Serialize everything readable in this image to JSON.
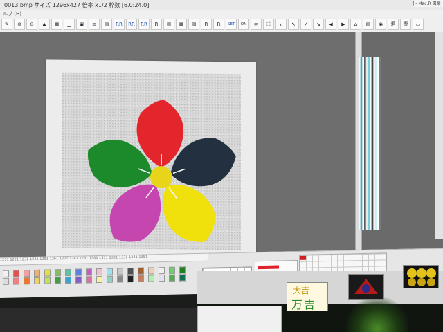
{
  "window": {
    "title": "0013.bmp サイズ 1296x427 倍率 x1/2 枠数 [6.0:24.0]",
    "side_title": "] - Mac.R 図案",
    "menu_fragment": "ルプ (H)"
  },
  "toolbar": {
    "buttons": [
      {
        "label": "✎",
        "name": "edit-tool-button"
      },
      {
        "label": "⊕",
        "name": "zoom-in-button"
      },
      {
        "label": "⊖",
        "name": "zoom-out-button"
      },
      {
        "label": "▲",
        "name": "fit-button"
      },
      {
        "label": "▦",
        "name": "grid-button"
      },
      {
        "label": "▁",
        "name": "baseline-button"
      },
      {
        "label": "▣",
        "name": "layer-button"
      },
      {
        "label": "≡",
        "name": "color-table-button"
      },
      {
        "label": "▤",
        "name": "palette-button"
      },
      {
        "label": "RR",
        "name": "rr-button-1"
      },
      {
        "label": "RR",
        "name": "rr-button-2"
      },
      {
        "label": "RR",
        "name": "rr-button-3"
      },
      {
        "label": "R",
        "name": "r-button-1"
      },
      {
        "label": "▥",
        "name": "pattern-button-1"
      },
      {
        "label": "▦",
        "name": "pattern-button-2"
      },
      {
        "label": "▧",
        "name": "pattern-button-3"
      },
      {
        "label": "R",
        "name": "r-button-2"
      },
      {
        "label": "R",
        "name": "r-button-3"
      },
      {
        "label": "SET",
        "name": "set-button"
      },
      {
        "label": "ON OFF",
        "name": "on-off-toggle"
      },
      {
        "label": "⇄",
        "name": "swap-button"
      },
      {
        "label": "⛶",
        "name": "binoculars-button"
      },
      {
        "label": "↙",
        "name": "arrow-button-1"
      },
      {
        "label": "↖",
        "name": "arrow-button-2"
      },
      {
        "label": "↗",
        "name": "arrow-button-3"
      },
      {
        "label": "↘",
        "name": "arrow-button-4"
      },
      {
        "label": "◀",
        "name": "prev-button"
      },
      {
        "label": "▶",
        "name": "next-button"
      },
      {
        "label": "⌂",
        "name": "home-button"
      },
      {
        "label": "▤",
        "name": "list-button"
      },
      {
        "label": "◉",
        "name": "color-wheel-button"
      },
      {
        "label": "退",
        "name": "undo-button"
      },
      {
        "label": "復",
        "name": "redo-button"
      },
      {
        "label": "▭",
        "name": "window-button"
      }
    ]
  },
  "design": {
    "petals": [
      {
        "color": "#e2262b",
        "name": "red-petal"
      },
      {
        "color": "#23303f",
        "name": "navy-petal"
      },
      {
        "color": "#f0e10c",
        "name": "yellow-petal"
      },
      {
        "color": "#c646b0",
        "name": "magenta-petal"
      },
      {
        "color": "#1c8a2a",
        "name": "green-petal"
      }
    ],
    "center_color": "#e8d418"
  },
  "stripes": [
    "#f4f4f4",
    "#3ab0c8",
    "#ffffff",
    "#5a5a5a",
    "#e8e8e8",
    "#6fd0e0",
    "#ffffff",
    "#444444",
    "#f0f0f0",
    "#c8f0f4",
    "#ffffff",
    "#7a7a7a"
  ],
  "bottom": {
    "ruler_text": "1211 1221 1231 1241 1251 1261 1271 1281 1291 1301 1311 1321 1331 1341 1351",
    "thumb1_top": "大吉",
    "thumb1_bottom": "万吉"
  },
  "palette": {
    "colors": [
      "#f2f2f2",
      "#dcdcdc",
      "#e05050",
      "#f08080",
      "#f0a0a0",
      "#e87830",
      "#f0b070",
      "#f0d060",
      "#e0e040",
      "#c0e060",
      "#80c060",
      "#40a040",
      "#60c0a0",
      "#40a0d0",
      "#6080e0",
      "#8060c0",
      "#c060c0",
      "#e070a0",
      "#f0c0d0",
      "#f6f0a0",
      "#a0e0f0",
      "#90d0c0",
      "#c8c8c8",
      "#888888",
      "#505050",
      "#202020",
      "#a06030",
      "#c08060",
      "#f0d0b0",
      "#b0f0b0",
      "#f0f0f0",
      "#e0e0f0",
      "#70d070",
      "#50b050",
      "#208020",
      "#107050"
    ]
  }
}
